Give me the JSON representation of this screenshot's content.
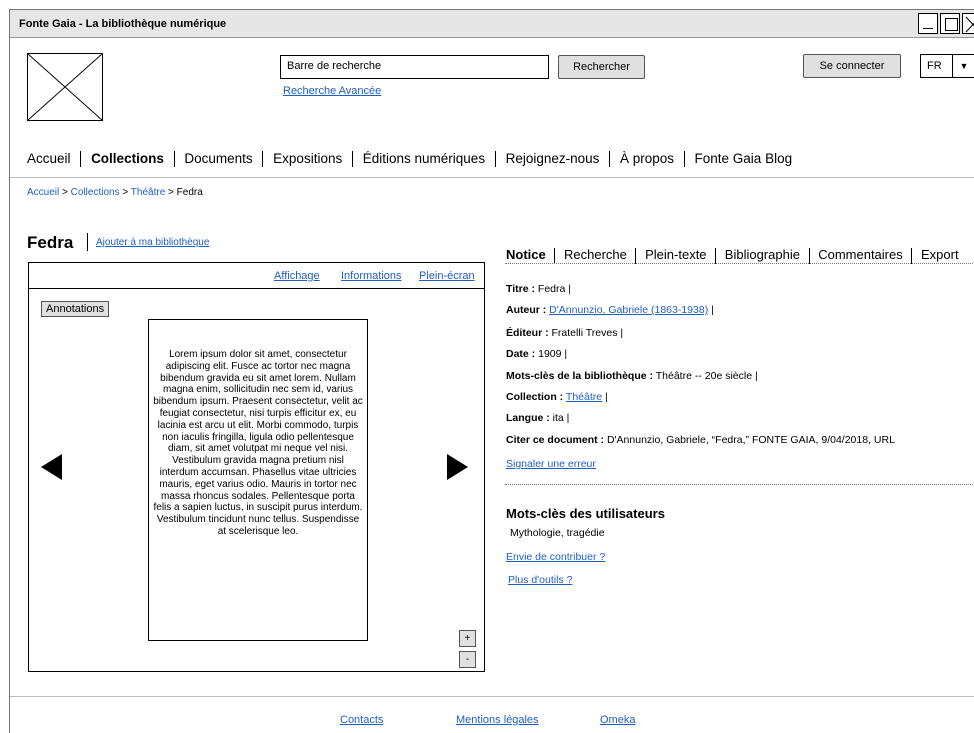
{
  "window": {
    "title": "Fonte Gaia - La bibliothèque numérique"
  },
  "header": {
    "search_value": "Barre de recherche",
    "search_button": "Rechercher",
    "advanced_link": "Recherche Avancée",
    "login_button": "Se connecter",
    "language": "FR"
  },
  "nav": {
    "items": [
      "Accueil",
      "Collections",
      "Documents",
      "Expositions",
      "Éditions numériques",
      "Rejoignez-nous",
      "À propos",
      "Fonte Gaia Blog"
    ],
    "active_index": 1
  },
  "breadcrumb": {
    "home": "Accueil",
    "collections": "Collections",
    "theatre": "Théâtre",
    "current": "Fedra"
  },
  "document": {
    "title": "Fedra",
    "add_link": "Ajouter à ma bibliothèque"
  },
  "viewer": {
    "tabs": [
      "Affichage",
      "Informations",
      "Plein-écran"
    ],
    "annotations_button": "Annotations",
    "page_text": "Lorem ipsum dolor sit amet, consectetur adipiscing elit. Fusce ac tortor nec magna bibendum gravida eu sit amet lorem. Nullam magna enim, sollicitudin nec sem id, varius bibendum ipsum. Praesent consectetur, velit ac feugiat consectetur, nisi turpis efficitur ex, eu lacinia est arcu ut elit. Morbi commodo, turpis non iaculis fringilla, ligula odio pellentesque diam, sit amet volutpat mi neque vel nisi. Vestibulum gravida magna pretium nisl interdum accumsan. Phasellus vitae ultricies mauris, eget varius odio. Mauris in tortor nec massa rhoncus sodales. Pellentesque porta felis a sapien luctus, in suscipit purus interdum. Vestibulum tincidunt nunc tellus. Suspendisse at scelerisque leo.",
    "zoom_in": "+",
    "zoom_out": "-"
  },
  "tabs": {
    "items": [
      "Notice",
      "Recherche",
      "Plein-texte",
      "Bibliographie",
      "Commentaires",
      "Export"
    ],
    "active_index": 0
  },
  "notice": {
    "titre_label": "Titre :",
    "titre_value": "Fedra |",
    "auteur_label": "Auteur :",
    "auteur_value": "D'Annunzio, Gabriele (1863-1938)",
    "auteur_suffix": "|",
    "editeur_label": "Éditeur :",
    "editeur_value": "Fratelli Treves |",
    "date_label": "Date :",
    "date_value": "1909 |",
    "motscles_label": "Mots-clès de la bibliothèque :",
    "motscles_value": "Théâtre -- 20e siècle |",
    "collection_label": "Collection :",
    "collection_value": "Théâtre",
    "collection_suffix": "|",
    "langue_label": "Langue :",
    "langue_value": "ita |",
    "citer_label": "Citer ce document :",
    "citer_value": "D'Annunzio, Gabriele, “Fedra,” FONTE GAIA, 9/04/2018, URL",
    "report_link": "Signaler une erreur"
  },
  "user_keywords": {
    "title": "Mots-clès des utilisateurs",
    "value": "Mythologie, tragédie",
    "contribute_link": "Envie de contribuer ?",
    "tools_link": "Plus d'outils ?"
  },
  "footer": {
    "contacts": "Contacts",
    "legal": "Mentions légales",
    "omeka": "Omeka"
  }
}
